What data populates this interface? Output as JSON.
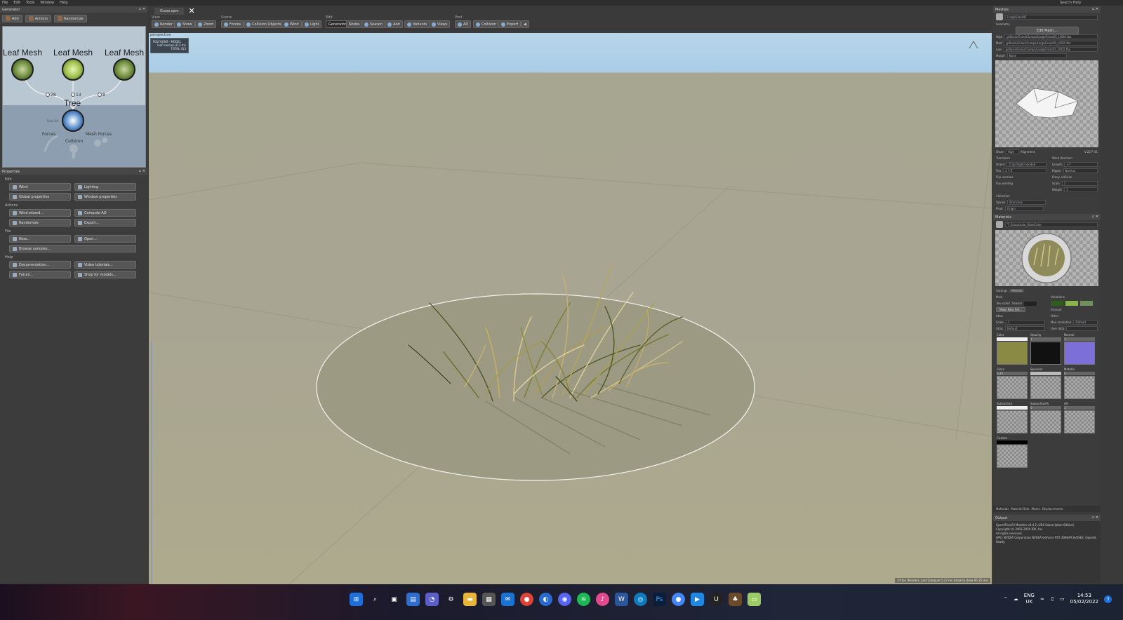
{
  "menu": {
    "items": [
      "File",
      "Edit",
      "Tools",
      "Window",
      "Help"
    ],
    "search_label": "Search Help"
  },
  "generator": {
    "title": "Generator",
    "toolbar": [
      "Add",
      "Actions",
      "Randomize"
    ],
    "nodes": {
      "leaf_label": "Leaf Mesh",
      "tree_label": "Tree",
      "tree_sub": "Base  80"
    },
    "counts": [
      "28",
      "13",
      "8"
    ],
    "bottom": {
      "forces": "Forces",
      "mesh_forces": "Mesh Forces",
      "collision": "Collision"
    }
  },
  "properties": {
    "title": "Properties",
    "sections": [
      {
        "label": "Edit",
        "buttons": [
          "Wind",
          "Lighting",
          "Global properties",
          "Window properties"
        ]
      },
      {
        "label": "Actions",
        "buttons": [
          "Wind wizard...",
          "Compute AO",
          "Randomize",
          "Export..."
        ]
      },
      {
        "label": "File",
        "buttons": [
          "New...",
          "Open...",
          "Browse samples..."
        ]
      },
      {
        "label": "Help",
        "buttons": [
          "Documentation...",
          "Video tutorials...",
          "Forum...",
          "Shop for models..."
        ]
      }
    ]
  },
  "document": {
    "tab": "Grass.spm",
    "close_glyph": "✕"
  },
  "toolbar": {
    "groups": [
      {
        "label": "View",
        "buttons": [
          "Render",
          "Show",
          "Zoom"
        ]
      },
      {
        "label": "Scene",
        "buttons": [
          "Forces",
          "Collision Objects",
          "Wind",
          "Light"
        ]
      },
      {
        "label": "Edit",
        "buttons": [
          "Generators",
          "Nodes",
          "Season",
          "Add",
          "Variants",
          "Views"
        ]
      },
      {
        "label": "Post",
        "buttons": [
          "AO",
          "Collision",
          "Export"
        ]
      }
    ],
    "active": "Generators"
  },
  "viewport": {
    "mode": "perspective",
    "stats": [
      "POLYGONS - MODEL",
      "leaf meshes  413 tris",
      "TOTAL  413"
    ],
    "status": "24 fps (Render), Last Compute 5.27 ms (draw to draw 95.35 ms)"
  },
  "meshes": {
    "title": "Meshes",
    "selected": "LargeGrass01",
    "geometry_label": "Geometry",
    "edit_mesh": "Edit Mesh...",
    "lods": [
      {
        "label": "High",
        "value": "grBasin/GrassClumps/LargeGrass01_LOD0.fbx"
      },
      {
        "label": "Med",
        "value": "grBasin/GrassClumps/LargeGrass01_LOD1.fbx"
      },
      {
        "label": "Low",
        "value": "grBasin/GrassClumps/LargeGrass01_LOD2.fbx"
      },
      {
        "label": "Morph",
        "value": "None"
      }
    ],
    "show": "High",
    "alignment": "Alignment",
    "counts": "V:22 P:41",
    "transform": {
      "title": "Transform",
      "orient": "Z Up Right-handed",
      "flip": "X Y Z",
      "flip_normals": "Flip normals",
      "flip_winding": "Flip winding"
    },
    "wind": {
      "title": "Wind direction",
      "growth": "+Y",
      "ripple": "Normal"
    },
    "proxy": {
      "title": "Proxy collision",
      "scale": "1",
      "weight": "1"
    },
    "collection": {
      "label": "Collection",
      "spines": "Branches",
      "pivot": "Origin"
    }
  },
  "materials": {
    "title": "Materials",
    "selected": "T_Grassclular_BaseColor",
    "tabs": [
      "Settings",
      "Meshes"
    ],
    "settings": {
      "main": "Main",
      "two_sided": "Two-sided",
      "season": "Season",
      "make_new_set": "Make New Set...",
      "variations": "Variations",
      "amount": "Amount",
      "atlas": "Atlas",
      "scale": "Scale",
      "atlas_mode": "Default",
      "other": "Other",
      "max_res": "Max resolution",
      "max_res_val": "Default",
      "user_data": "User data"
    },
    "variation_colors": [
      "#2f5d1e",
      "#8bb34a",
      "#6f8f5c"
    ],
    "textures": [
      {
        "label": "Color",
        "val": ""
      },
      {
        "label": "Opacity",
        "val": "1"
      },
      {
        "label": "Normal",
        "val": "1"
      },
      {
        "label": "Gloss",
        "val": "0.25"
      },
      {
        "label": "Specular",
        "val": ""
      },
      {
        "label": "Metallic",
        "val": "0"
      },
      {
        "label": "Subsurface",
        "val": ""
      },
      {
        "label": "Subsurface%",
        "val": "0"
      },
      {
        "label": "AO",
        "val": "1"
      },
      {
        "label": "Custom",
        "val": ""
      }
    ],
    "bottom_tabs": [
      "Materials",
      "Material Sets",
      "Masks",
      "Displacements"
    ]
  },
  "output": {
    "title": "Output",
    "lines": [
      "SpeedTree(R) Modeler v9.4.2 (UE4 Subscription Edition)",
      "Copyright (c) 2003-2020 IDV, Inc.",
      "All rights reserved.",
      "GPU: NVIDIA Corporation NVIDIA GeForce RTX 3060/PCIe/SSE2, OpenGL",
      "Ready."
    ]
  },
  "taskbar": {
    "apps": [
      "windows-start",
      "search",
      "task-view",
      "widgets",
      "chat",
      "settings",
      "file-explorer",
      "store",
      "mail",
      "chrome",
      "edge",
      "discord",
      "spotify",
      "itunes",
      "word",
      "browser",
      "photoshop",
      "chrome-alt",
      "media",
      "unreal",
      "speedtree",
      "notepad"
    ],
    "lang": "ENG",
    "region": "UK",
    "time": "14:53",
    "date": "05/02/2022",
    "notif": "3"
  }
}
